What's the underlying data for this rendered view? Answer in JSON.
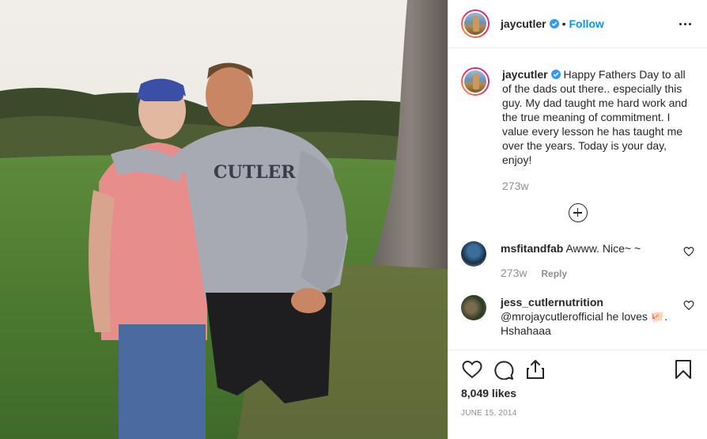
{
  "post": {
    "username": "jaycutler",
    "follow_label": "Follow",
    "separator": "•",
    "caption": {
      "username": "jaycutler",
      "text": "Happy Fathers Day to all of the dads out there.. especially this guy. My dad taught me hard work and the true meaning of commitment. I value every lesson he has taught me over the years. Today is your day, enjoy!",
      "time": "273w"
    },
    "comments": [
      {
        "username": "msfitandfab",
        "text": "Awww. Nice~ ~",
        "time": "273w",
        "reply_label": "Reply"
      },
      {
        "username": "jess_cutlernutrition",
        "text_before": "@mrojaycutlerofficial he loves",
        "emoji": "🐖",
        "text_after": ". Hshahaaa"
      }
    ],
    "likes": "8,049 likes",
    "date": "JUNE 15, 2014",
    "shirt_text": "CUTLER"
  },
  "colors": {
    "link_blue": "#0095f6",
    "verified_blue": "#3897f0",
    "muted": "#8e8e8e",
    "border": "#efefef"
  },
  "icons": [
    "verified-badge-icon",
    "more-options-icon",
    "load-more-comments-icon",
    "heart-icon",
    "comment-icon",
    "share-icon",
    "bookmark-icon"
  ]
}
